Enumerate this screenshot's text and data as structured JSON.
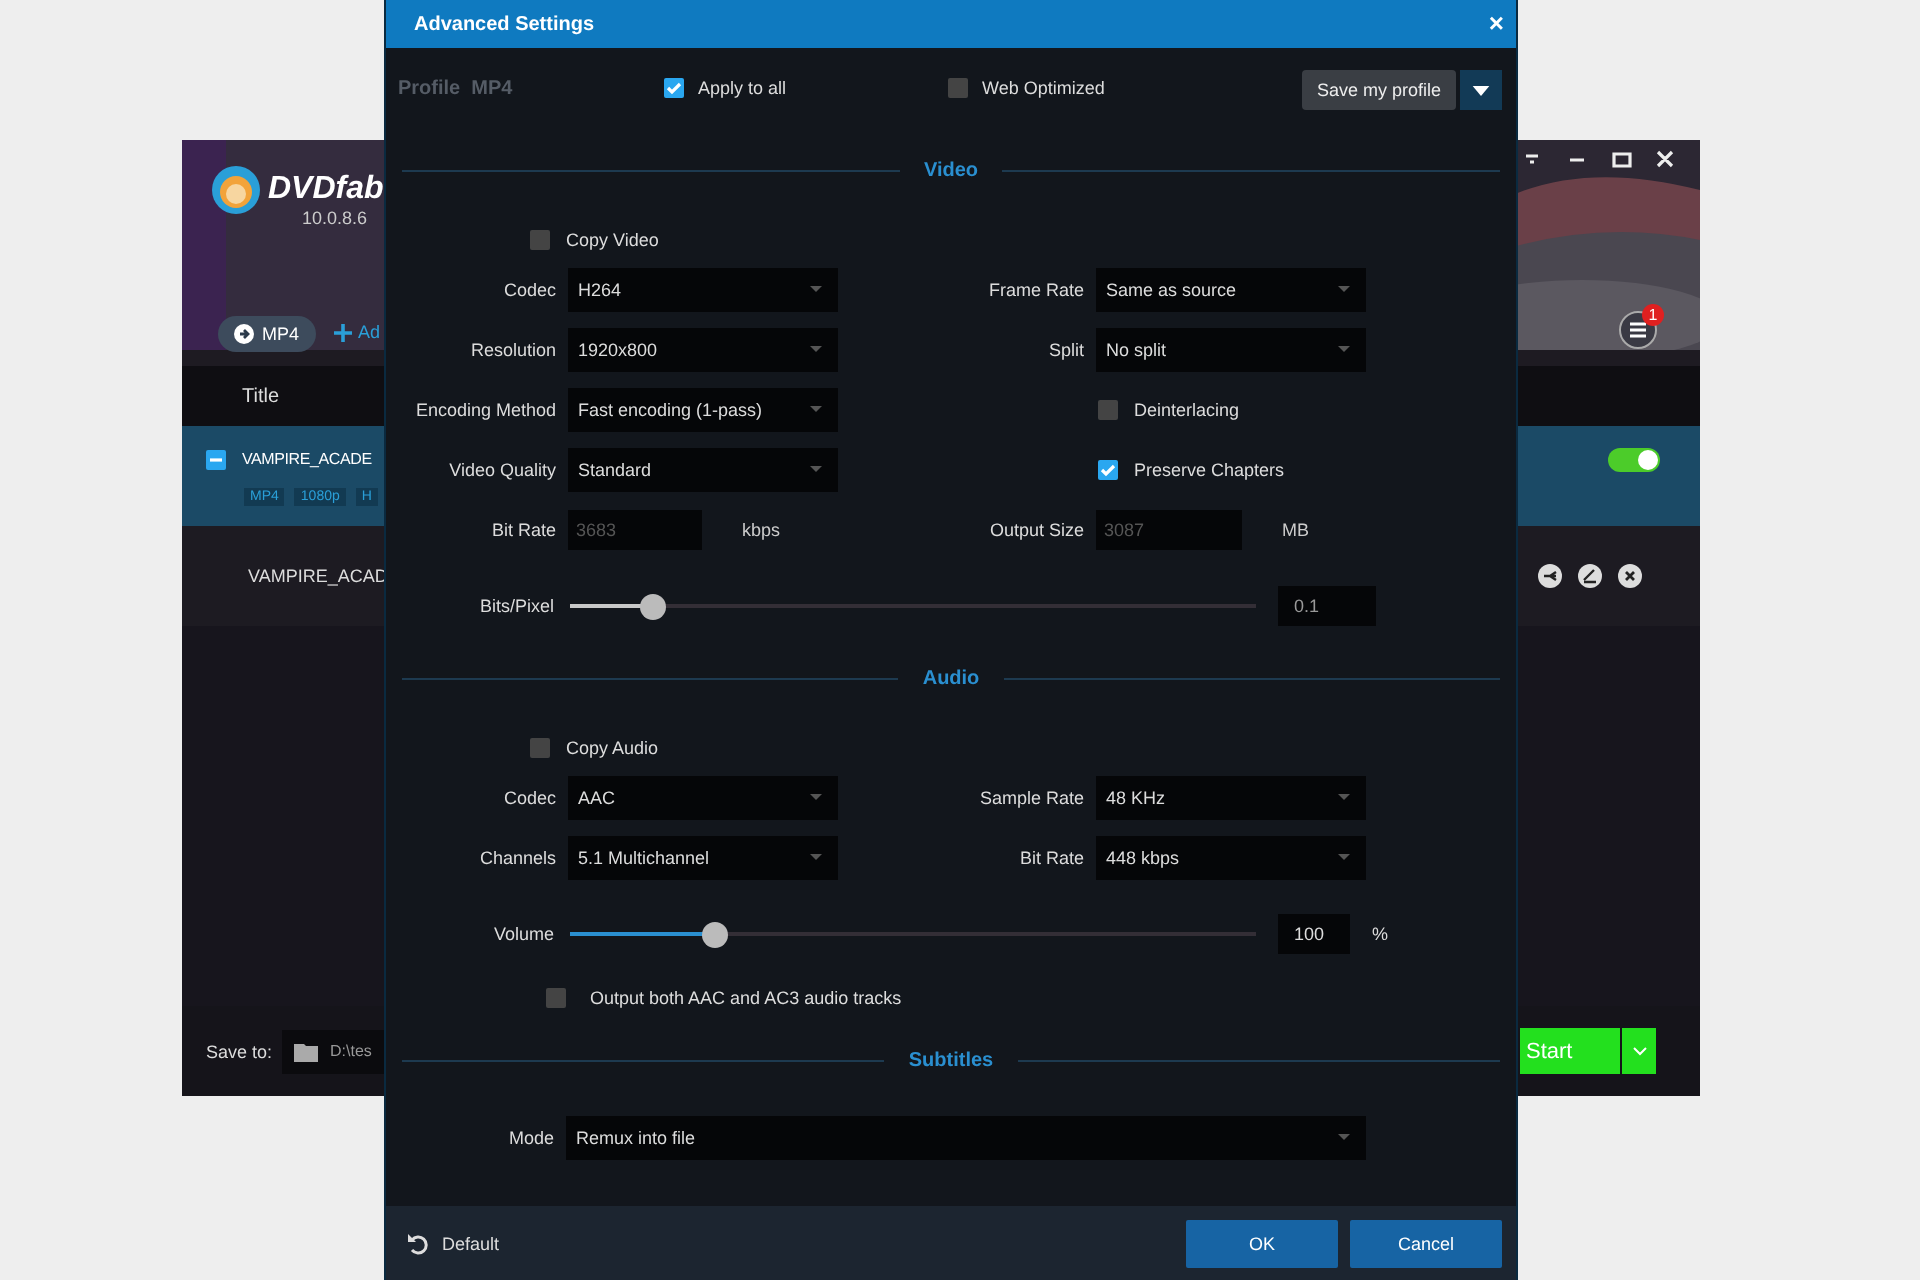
{
  "app": {
    "logo_text": "DVDfab",
    "version": "10.0.8.6",
    "profile_button": "MP4",
    "add_link": "Ad",
    "column": "Title",
    "titles": [
      {
        "name": "VAMPIRE_ACADE",
        "tags": [
          "MP4",
          "1080p",
          "H"
        ],
        "enabled": true
      }
    ],
    "subtitle": "VAMPIRE_ACAD",
    "badge": "1",
    "save_to_label": "Save to:",
    "save_path": "D:\\tes",
    "start": "Start"
  },
  "dialog": {
    "title": "Advanced Settings",
    "close": "×",
    "profile": "Profile  MP4",
    "options": [
      {
        "label": "Apply to all",
        "checked": true
      },
      {
        "label": "Web Optimized",
        "checked": false
      }
    ],
    "save_button": "Save my profile",
    "video": {
      "title": "Video",
      "copy": {
        "label": "Copy Video",
        "checked": false
      },
      "rows": [
        [
          {
            "kind": "select",
            "label": "Codec",
            "value": "H264"
          },
          {
            "kind": "select",
            "label": "Frame Rate",
            "value": "Same as source"
          }
        ],
        [
          {
            "kind": "select",
            "label": "Resolution",
            "value": "1920x800"
          },
          {
            "kind": "select",
            "label": "Split",
            "value": "No split"
          }
        ],
        [
          {
            "kind": "select",
            "label": "Encoding Method",
            "value": "Fast encoding (1-pass)"
          },
          {
            "kind": "checkbox",
            "label": "Deinterlacing",
            "checked": false
          }
        ],
        [
          {
            "kind": "select",
            "label": "Video Quality",
            "value": "Standard"
          },
          {
            "kind": "checkbox",
            "label": "Preserve Chapters",
            "checked": true
          }
        ],
        [
          {
            "kind": "input",
            "label": "Bit Rate",
            "value": "3683",
            "unit": "kbps",
            "disabled": true
          },
          {
            "kind": "input",
            "label": "Output Size",
            "value": "3087",
            "unit": "MB",
            "disabled": true
          }
        ]
      ],
      "slider": {
        "label": "Bits/Pixel",
        "level": 0.12,
        "value": "0.1",
        "disabled": true
      }
    },
    "audio": {
      "title": "Audio",
      "copy": {
        "label": "Copy Audio",
        "checked": false
      },
      "rows": [
        [
          {
            "kind": "select",
            "label": "Codec",
            "value": "AAC"
          },
          {
            "kind": "select",
            "label": "Sample Rate",
            "value": "48 KHz"
          }
        ],
        [
          {
            "kind": "select",
            "label": "Channels",
            "value": "5.1 Multichannel"
          },
          {
            "kind": "select",
            "label": "Bit Rate",
            "value": "448 kbps"
          }
        ]
      ],
      "slider": {
        "label": "Volume",
        "level": 0.21,
        "value": "100",
        "unit": "%",
        "disabled": false
      },
      "extra": {
        "label": "Output both AAC and AC3 audio tracks",
        "checked": false
      }
    },
    "subtitles": {
      "title": "Subtitles",
      "mode": {
        "label": "Mode",
        "value": "Remux into file"
      }
    },
    "default_button": "Default",
    "buttons": [
      "OK",
      "Cancel"
    ]
  }
}
